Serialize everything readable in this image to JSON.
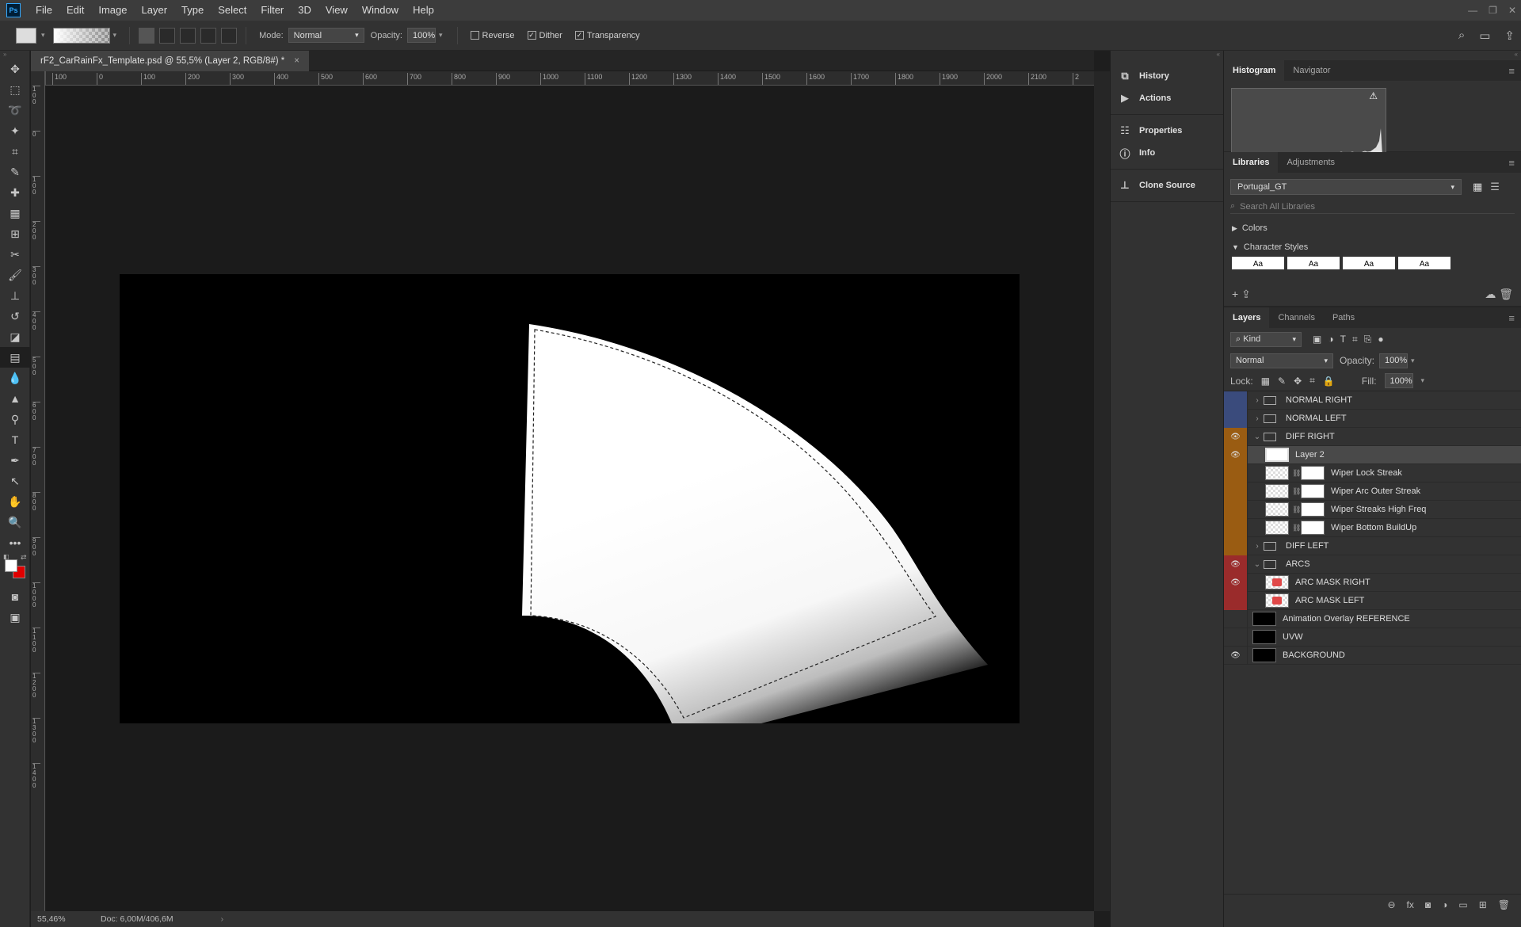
{
  "menubar": {
    "logo": "Ps",
    "items": [
      "File",
      "Edit",
      "Image",
      "Layer",
      "Type",
      "Select",
      "Filter",
      "3D",
      "View",
      "Window",
      "Help"
    ]
  },
  "options": {
    "mode_label": "Mode:",
    "mode_value": "Normal",
    "opacity_label": "Opacity:",
    "opacity_value": "100%",
    "reverse_label": "Reverse",
    "reverse_checked": false,
    "dither_label": "Dither",
    "dither_checked": true,
    "transparency_label": "Transparency",
    "transparency_checked": true
  },
  "document": {
    "tab_title": "rF2_CarRainFx_Template.psd @ 55,5% (Layer 2, RGB/8#) *",
    "close_glyph": "×"
  },
  "ruler_h_labels": [
    "100",
    "0",
    "100",
    "200",
    "300",
    "400",
    "500",
    "600",
    "700",
    "800",
    "900",
    "1000",
    "1100",
    "1200",
    "1300",
    "1400",
    "1500",
    "1600",
    "1700",
    "1800",
    "1900",
    "2000",
    "2100",
    "2"
  ],
  "ruler_v_labels": [
    "1 0 0",
    "0",
    "1 0 0",
    "2 0 0",
    "3 0 0",
    "4 0 0",
    "5 0 0",
    "6 0 0",
    "7 0 0",
    "8 0 0",
    "9 0 0",
    "1 0 0 0",
    "1 1 0 0",
    "1 2 0 0",
    "1 3 0 0",
    "1 4 0 0"
  ],
  "status": {
    "zoom": "55,46%",
    "doc": "Doc: 6,00M/406,6M"
  },
  "dock": {
    "items": [
      "History",
      "Actions",
      "Properties",
      "Info",
      "Clone Source"
    ]
  },
  "histogram": {
    "tabs": [
      "Histogram",
      "Navigator"
    ]
  },
  "libraries": {
    "tabs": [
      "Libraries",
      "Adjustments"
    ],
    "library_name": "Portugal_GT",
    "search_placeholder": "Search All Libraries",
    "sections": [
      "Colors",
      "Character Styles"
    ],
    "cs_sample": "Aa"
  },
  "layers": {
    "tabs": [
      "Layers",
      "Channels",
      "Paths"
    ],
    "filter_kind": "Kind",
    "blend_mode": "Normal",
    "opacity_label": "Opacity:",
    "opacity_value": "100%",
    "lock_label": "Lock:",
    "fill_label": "Fill:",
    "fill_value": "100%",
    "rows": [
      {
        "name": "NORMAL RIGHT",
        "type": "group",
        "color": "blue",
        "visible": false,
        "expanded": false,
        "indent": 0
      },
      {
        "name": "NORMAL LEFT",
        "type": "group",
        "color": "blue",
        "visible": false,
        "expanded": false,
        "indent": 0
      },
      {
        "name": "DIFF RIGHT",
        "type": "group",
        "color": "orange",
        "visible": true,
        "expanded": true,
        "indent": 0
      },
      {
        "name": "Layer 2",
        "type": "layer",
        "color": "orange",
        "visible": true,
        "indent": 1,
        "selected": true,
        "thumb": "white-shape"
      },
      {
        "name": "Wiper Lock Streak",
        "type": "masked",
        "color": "orange",
        "visible": false,
        "indent": 1
      },
      {
        "name": "Wiper Arc Outer Streak",
        "type": "masked",
        "color": "orange",
        "visible": false,
        "indent": 1
      },
      {
        "name": "Wiper Streaks High Freq",
        "type": "masked",
        "color": "orange",
        "visible": false,
        "indent": 1
      },
      {
        "name": "Wiper Bottom BuildUp",
        "type": "masked",
        "color": "orange",
        "visible": false,
        "indent": 1
      },
      {
        "name": "DIFF LEFT",
        "type": "group",
        "color": "orange",
        "visible": false,
        "expanded": false,
        "indent": 0
      },
      {
        "name": "ARCS",
        "type": "group",
        "color": "red",
        "visible": true,
        "expanded": true,
        "indent": 0
      },
      {
        "name": "ARC MASK RIGHT",
        "type": "layer",
        "color": "red",
        "visible": true,
        "indent": 1,
        "thumb": "red"
      },
      {
        "name": "ARC MASK LEFT",
        "type": "layer",
        "color": "red",
        "visible": false,
        "indent": 1,
        "thumb": "red"
      },
      {
        "name": "Animation Overlay REFERENCE",
        "type": "layer",
        "color": "none",
        "visible": false,
        "indent": 0,
        "thumb": "dark"
      },
      {
        "name": "UVW",
        "type": "layer",
        "color": "none",
        "visible": false,
        "indent": 0,
        "thumb": "dark"
      },
      {
        "name": "BACKGROUND",
        "type": "layer",
        "color": "none",
        "visible": true,
        "indent": 0,
        "thumb": "dark"
      }
    ]
  },
  "colors": {
    "foreground": "#ffffff",
    "background": "#e00000",
    "tag_blue": "#3a4b7c",
    "tag_orange": "#9a5c12",
    "tag_red": "#9a2b2b"
  }
}
